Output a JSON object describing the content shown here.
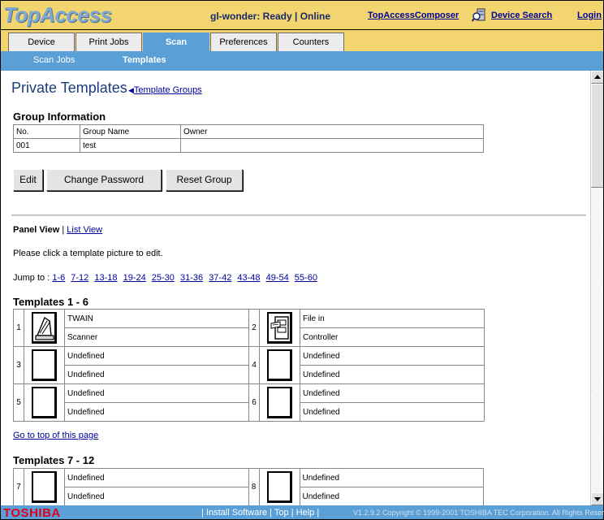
{
  "header": {
    "logo": "TopAccess",
    "status": "gl-wonder: Ready | Online",
    "composer_link": "TopAccessComposer",
    "device_search": "Device Search",
    "login": "Login"
  },
  "tabs": [
    {
      "label": "Device",
      "active": false
    },
    {
      "label": "Print Jobs",
      "active": false
    },
    {
      "label": "Scan",
      "active": true
    },
    {
      "label": "Preferences",
      "active": false
    },
    {
      "label": "Counters",
      "active": false
    }
  ],
  "subtabs": [
    {
      "label": "Scan Jobs",
      "active": false
    },
    {
      "label": "Templates",
      "active": true
    }
  ],
  "page": {
    "heading": "Private Templates",
    "group_link": "Template Groups"
  },
  "group_info": {
    "title": "Group Information",
    "headers": [
      "No.",
      "Group Name",
      "Owner"
    ],
    "row": [
      "001",
      "test",
      ""
    ]
  },
  "buttons": {
    "edit": "Edit",
    "change_password": "Change Password",
    "reset_group": "Reset Group"
  },
  "views": {
    "panel": "Panel View",
    "separator": "|",
    "list": "List View"
  },
  "instruction": "Please click a template picture to edit.",
  "jump": {
    "label": "Jump to :",
    "ranges": [
      "1-6",
      "7-12",
      "13-18",
      "19-24",
      "25-30",
      "31-36",
      "37-42",
      "43-48",
      "49-54",
      "55-60"
    ]
  },
  "template_sections": [
    {
      "title": "Templates   1 - 6",
      "items": [
        {
          "num": "1",
          "icon": "scanner-icon",
          "line1": "TWAIN",
          "line2": "Scanner"
        },
        {
          "num": "2",
          "icon": "file-cabinet-icon",
          "line1": "File in",
          "line2": "Controller"
        },
        {
          "num": "3",
          "icon": "blank-template-icon",
          "line1": "Undefined",
          "line2": "Undefined"
        },
        {
          "num": "4",
          "icon": "blank-template-icon",
          "line1": "Undefined",
          "line2": "Undefined"
        },
        {
          "num": "5",
          "icon": "blank-template-icon",
          "line1": "Undefined",
          "line2": "Undefined"
        },
        {
          "num": "6",
          "icon": "blank-template-icon",
          "line1": "Undefined",
          "line2": "Undefined"
        }
      ]
    },
    {
      "title": "Templates   7 - 12",
      "items": [
        {
          "num": "7",
          "icon": "blank-template-icon",
          "line1": "Undefined",
          "line2": "Undefined"
        },
        {
          "num": "8",
          "icon": "blank-template-icon",
          "line1": "Undefined",
          "line2": "Undefined"
        }
      ]
    }
  ],
  "goto_top": "Go to top of this page",
  "footer": {
    "brand": "TOSHIBA",
    "links": [
      "Install Software",
      "Top",
      "Help"
    ],
    "copyright": "V1.2.9.2  Copyright © 1999-2001 TOSHIBA TEC Corporation. All Rights Reserved."
  },
  "colors": {
    "header_bg": "#f2d56e",
    "nav_blue": "#5a9fd5",
    "link": "#00009c",
    "brand_red": "#e0001b"
  }
}
